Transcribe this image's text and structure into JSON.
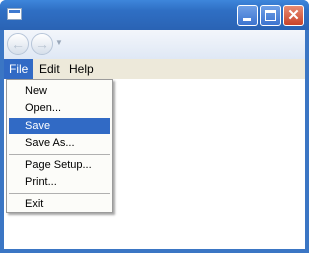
{
  "window": {
    "title": "",
    "icon": "window-app-icon",
    "controls": {
      "minimize": "minimize-icon",
      "maximize": "maximize-icon",
      "close": "close-icon",
      "close_glyph": "✕"
    }
  },
  "navigation": {
    "back_glyph": "←",
    "forward_glyph": "→",
    "dropdown_glyph": "▼"
  },
  "menubar": {
    "items": [
      {
        "label": "File"
      },
      {
        "label": "Edit"
      },
      {
        "label": "Help"
      }
    ]
  },
  "file_menu": {
    "items": [
      {
        "label": "New"
      },
      {
        "label": "Open..."
      },
      {
        "label": "Save",
        "highlighted": true
      },
      {
        "label": "Save As..."
      },
      {
        "label": "Page Setup..."
      },
      {
        "label": "Print..."
      },
      {
        "label": "Exit"
      }
    ]
  },
  "colors": {
    "titlebar": "#2f6fc4",
    "highlight": "#316ac5",
    "menubar_bg": "#ede9da",
    "close_button": "#c8432a"
  }
}
